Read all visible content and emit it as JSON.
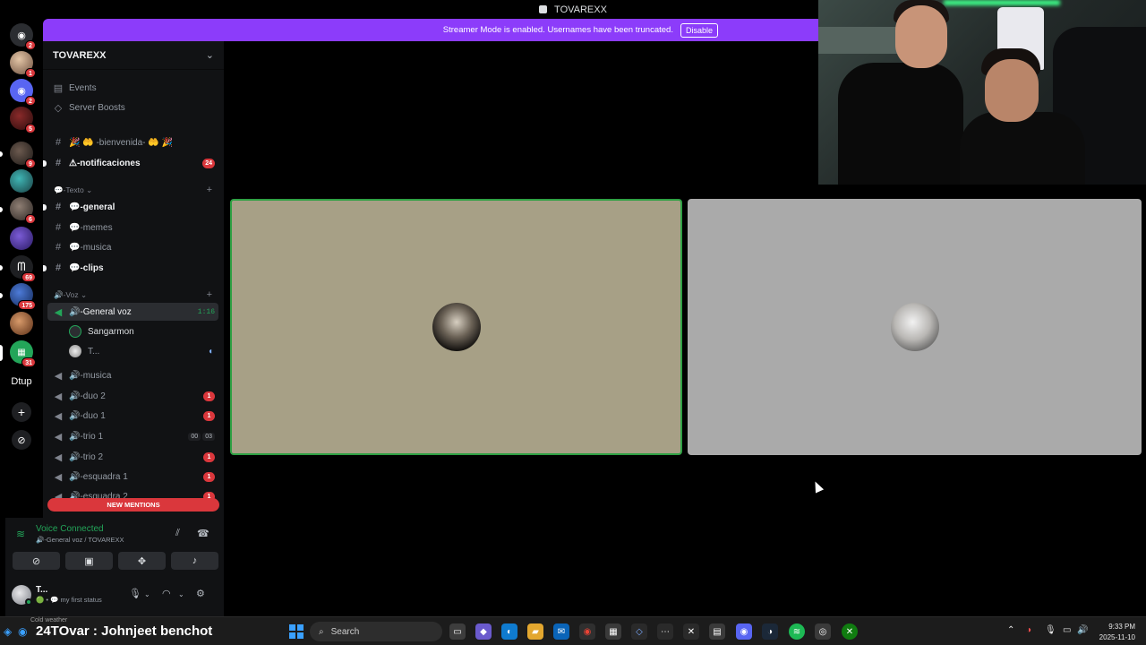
{
  "window": {
    "title": "TOVAREXX"
  },
  "banner": {
    "text": "Streamer Mode is enabled. Usernames have been truncated.",
    "disable_label": "Disable"
  },
  "rail": {
    "badges": [
      "2",
      "1",
      "2",
      "5",
      "9",
      "6",
      "69",
      "175",
      "31"
    ],
    "dtup_label": "Dtup",
    "add_label": "+",
    "explore_label": "⊘"
  },
  "server": {
    "name": "TOVAREXX",
    "chevron": "⌄"
  },
  "sidebar": {
    "events": "Events",
    "boosts": "Server Boosts",
    "welcome": "🎉 🤲 -bienvenida- 🤲 🎉",
    "notifications": "⚠-notificaciones",
    "notifications_badge": "24",
    "cat_text": "💬-Texto ⌄",
    "general": "💬-general",
    "memes": "💬-memes",
    "musica_text": "💬-musica",
    "clips": "💬-clips",
    "cat_voice": "🔊-Voz ⌄",
    "general_voz": "🔊-General voz",
    "general_voz_time": "1:16",
    "member1": "Sangarmon",
    "member2": "T...",
    "musica_voice": "🔊-musica",
    "duo2": "🔊-duo 2",
    "duo2_badge": "1",
    "duo1": "🔊-duo 1",
    "duo1_badge": "1",
    "trio1": "🔊-trio 1",
    "trio1_a": "00",
    "trio1_b": "03",
    "trio2": "🔊-trio 2",
    "trio2_badge": "1",
    "esq1": "🔊-esquadra 1",
    "esq1_badge": "1",
    "esq2": "🔊-esquadra 2",
    "esq2_badge": "1",
    "new_mentions": "NEW MENTIONS"
  },
  "voice": {
    "title": "Voice Connected",
    "subtitle": "🔊-General voz / TOVAREXX"
  },
  "user": {
    "name": "T...",
    "status": "🟢 • 💬 my first status"
  },
  "taskbar": {
    "overlay": "24TOvar : Johnjeet benchot",
    "weather": "Cold weather",
    "search": "Search",
    "time": "9:33 PM",
    "date": "2025-11-10"
  },
  "colors": {
    "accent": "#8c3cfa",
    "mention": "#da373c",
    "online": "#23a559",
    "speaking_border": "#2ea043"
  }
}
